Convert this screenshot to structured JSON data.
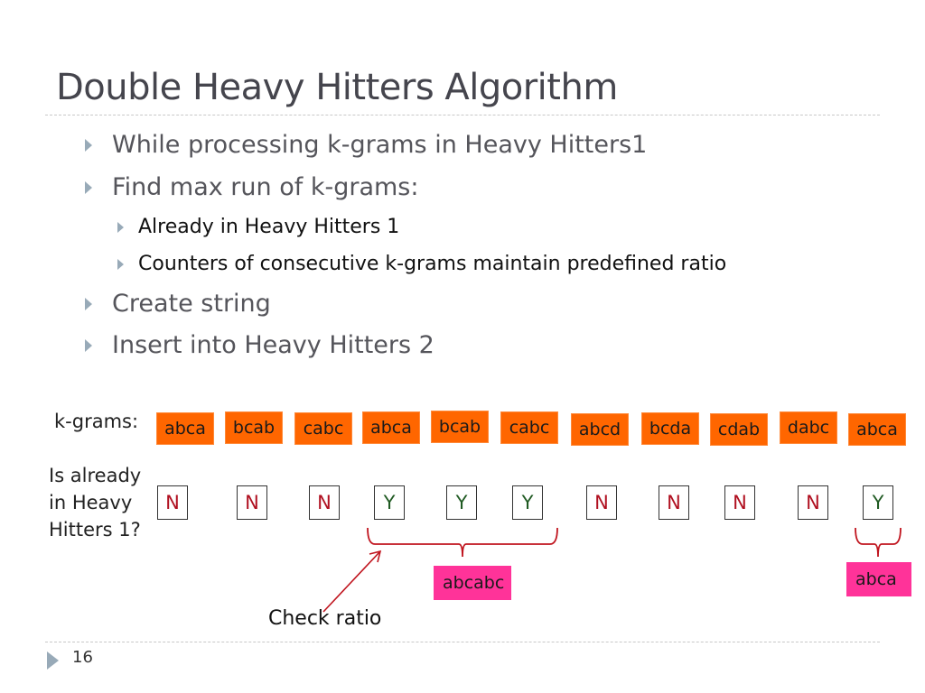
{
  "slide": {
    "title": "Double Heavy Hitters Algorithm",
    "page_number": "16",
    "bullets": [
      {
        "level": 1,
        "text": "While processing k-grams in Heavy Hitters1"
      },
      {
        "level": 1,
        "text": "Find max run of k-grams:"
      },
      {
        "level": 2,
        "text": "Already in Heavy Hitters 1"
      },
      {
        "level": 2,
        "text": "Counters of consecutive k-grams maintain predefined ratio"
      },
      {
        "level": 1,
        "text": "Create string"
      },
      {
        "level": 1,
        "text": "Insert into Heavy Hitters 2"
      }
    ]
  },
  "diagram": {
    "kgrams_label": "k-grams:",
    "membership_label": "Is already in Heavy Hitters 1?",
    "kgrams": [
      "abca",
      "bcab",
      "cabc",
      "abca",
      "bcab",
      "cabc",
      "abcd",
      "bcda",
      "cdab",
      "dabc",
      "abca"
    ],
    "in_heavy_hitters_1": [
      "N",
      "N",
      "N",
      "Y",
      "Y",
      "Y",
      "N",
      "N",
      "N",
      "N",
      "Y"
    ],
    "results": [
      {
        "text": "abcabc",
        "from_index": 3,
        "to_index": 5
      },
      {
        "text": "abca",
        "from_index": 10,
        "to_index": 10
      }
    ],
    "annotation": "Check ratio",
    "colors": {
      "kgram_box": "#ff6600",
      "result_box": "#ff3399",
      "no_text": "#b01020",
      "yes_text": "#1f5a22",
      "brace": "#c0141e",
      "bullet_arrow": "#98aab8"
    }
  }
}
